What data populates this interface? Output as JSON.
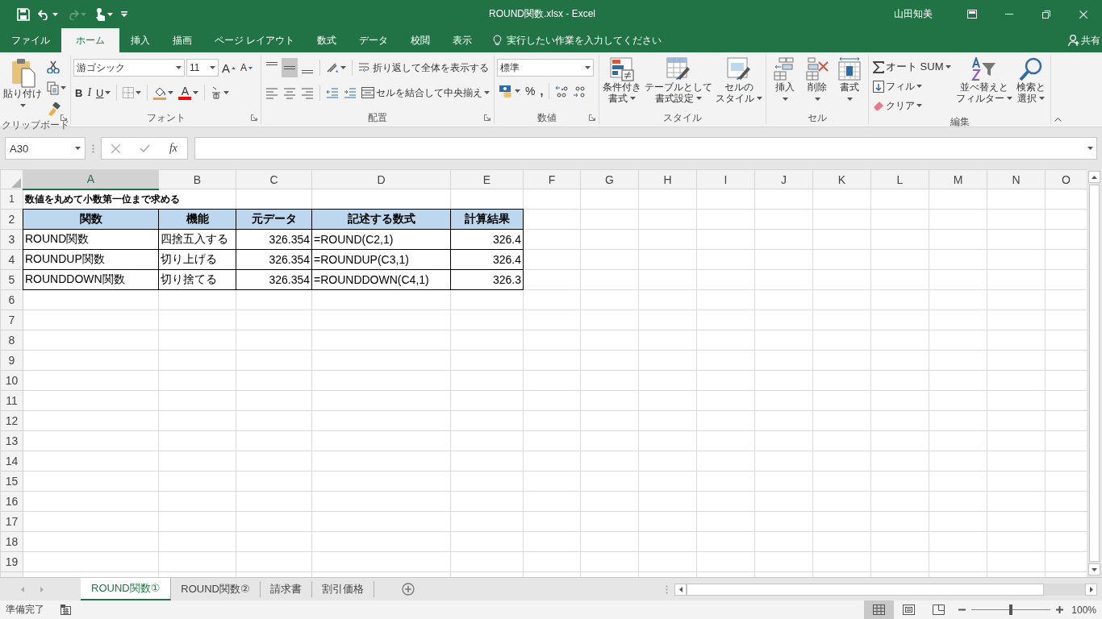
{
  "window": {
    "title": "ROUND関数.xlsx  -  Excel",
    "user": "山田知美"
  },
  "ribbon_tabs": [
    {
      "label": "ファイル",
      "selected": false
    },
    {
      "label": "ホーム",
      "selected": true
    },
    {
      "label": "挿入",
      "selected": false
    },
    {
      "label": "描画",
      "selected": false
    },
    {
      "label": "ページ レイアウト",
      "selected": false
    },
    {
      "label": "数式",
      "selected": false
    },
    {
      "label": "データ",
      "selected": false
    },
    {
      "label": "校閲",
      "selected": false
    },
    {
      "label": "表示",
      "selected": false
    }
  ],
  "tell_me": {
    "placeholder": "実行したい作業を入力してください"
  },
  "share": "共有",
  "ribbon": {
    "groups": [
      {
        "kind": "clipboard",
        "label": "クリップボード",
        "paste": "貼り付け"
      },
      {
        "kind": "font",
        "label": "フォント",
        "font_name": "游ゴシック",
        "font_size": "11",
        "grow": "A",
        "shrink": "A",
        "bold": "B",
        "italic": "I",
        "underline": "U",
        "font_color": "A"
      },
      {
        "kind": "alignment",
        "label": "配置",
        "vertical_align": [
          {
            "selected": false
          },
          {
            "selected": true
          },
          {
            "selected": false
          }
        ],
        "wrap_text": "折り返して全体を表示する",
        "merge_center": "セルを結合して中央揃え"
      },
      {
        "kind": "number",
        "label": "数値",
        "format": "標準",
        "percent": "%",
        "comma": ","
      },
      {
        "kind": "styles",
        "label": "スタイル",
        "buttons": [
          {
            "kind": "conditional",
            "label": [
              "条件付き",
              "書式"
            ]
          },
          {
            "kind": "table",
            "label": [
              "テーブルとして",
              "書式設定"
            ]
          },
          {
            "kind": "cell_styles",
            "label": [
              "セルの",
              "スタイル"
            ]
          }
        ]
      },
      {
        "kind": "cells",
        "label": "セル",
        "buttons": [
          {
            "kind": "insert",
            "label": "挿入"
          },
          {
            "kind": "delete",
            "label": "削除"
          },
          {
            "kind": "format",
            "label": "書式"
          }
        ]
      },
      {
        "kind": "editing",
        "label": "編集",
        "autosum": "オート SUM",
        "fill": "フィル",
        "clear": "クリア",
        "sort": [
          "並べ替えと",
          "フィルター"
        ],
        "find": [
          "検索と",
          "選択"
        ]
      }
    ]
  },
  "formula_bar": {
    "name_box": "A30",
    "function_label": "fx"
  },
  "columns": [
    {
      "label": "A",
      "selected": true
    },
    {
      "label": "B",
      "selected": false
    },
    {
      "label": "C",
      "selected": false
    },
    {
      "label": "D",
      "selected": false
    },
    {
      "label": "E",
      "selected": false
    },
    {
      "label": "F",
      "selected": false
    },
    {
      "label": "G",
      "selected": false
    },
    {
      "label": "H",
      "selected": false
    },
    {
      "label": "I",
      "selected": false
    },
    {
      "label": "J",
      "selected": false
    },
    {
      "label": "K",
      "selected": false
    },
    {
      "label": "L",
      "selected": false
    },
    {
      "label": "M",
      "selected": false
    },
    {
      "label": "N",
      "selected": false
    },
    {
      "label": "O",
      "selected": false
    }
  ],
  "rows": [
    {
      "number": "1",
      "kind": "title",
      "cells": [
        {
          "text": "数値を丸めて小数第一位まで求める",
          "kind": "text"
        }
      ]
    },
    {
      "number": "2",
      "kind": "header",
      "cells": [
        {
          "text": "関数",
          "kind": "text"
        },
        {
          "text": "機能",
          "kind": "text"
        },
        {
          "text": "元データ",
          "kind": "text"
        },
        {
          "text": "記述する数式",
          "kind": "text"
        },
        {
          "text": "計算結果",
          "kind": "text"
        }
      ]
    },
    {
      "number": "3",
      "kind": "data",
      "cells": [
        {
          "text": "ROUND関数",
          "kind": "text"
        },
        {
          "text": "四捨五入する",
          "kind": "text"
        },
        {
          "text": "326.354",
          "kind": "number"
        },
        {
          "text": "=ROUND(C2,1)",
          "kind": "text"
        },
        {
          "text": "326.4",
          "kind": "number"
        }
      ]
    },
    {
      "number": "4",
      "kind": "data",
      "cells": [
        {
          "text": "ROUNDUP関数",
          "kind": "text"
        },
        {
          "text": "切り上げる",
          "kind": "text"
        },
        {
          "text": "326.354",
          "kind": "number"
        },
        {
          "text": "=ROUNDUP(C3,1)",
          "kind": "text"
        },
        {
          "text": "326.4",
          "kind": "number"
        }
      ]
    },
    {
      "number": "5",
      "kind": "data",
      "cells": [
        {
          "text": "ROUNDDOWN関数",
          "kind": "text"
        },
        {
          "text": "切り捨てる",
          "kind": "text"
        },
        {
          "text": "326.354",
          "kind": "number"
        },
        {
          "text": "=ROUNDDOWN(C4,1)",
          "kind": "text"
        },
        {
          "text": "326.3",
          "kind": "number"
        }
      ]
    },
    {
      "number": "6",
      "kind": "empty"
    },
    {
      "number": "7",
      "kind": "empty"
    },
    {
      "number": "8",
      "kind": "empty"
    },
    {
      "number": "9",
      "kind": "empty"
    },
    {
      "number": "10",
      "kind": "empty"
    },
    {
      "number": "11",
      "kind": "empty"
    },
    {
      "number": "12",
      "kind": "empty"
    },
    {
      "number": "13",
      "kind": "empty"
    },
    {
      "number": "14",
      "kind": "empty"
    },
    {
      "number": "15",
      "kind": "empty"
    },
    {
      "number": "16",
      "kind": "empty"
    },
    {
      "number": "17",
      "kind": "empty"
    },
    {
      "number": "18",
      "kind": "empty"
    },
    {
      "number": "19",
      "kind": "empty"
    }
  ],
  "sheet_tabs": [
    {
      "label": "ROUND関数①",
      "selected": true
    },
    {
      "label": "ROUND関数②",
      "selected": false
    },
    {
      "label": "請求書",
      "selected": false
    },
    {
      "label": "割引価格",
      "selected": false
    }
  ],
  "status_bar": {
    "text": "準備完了",
    "view_modes": [
      {
        "kind": "normal",
        "selected": true
      },
      {
        "kind": "page_layout",
        "selected": false
      },
      {
        "kind": "page_break",
        "selected": false
      }
    ],
    "zoom": {
      "level": 0.5,
      "reading": "100%"
    }
  }
}
